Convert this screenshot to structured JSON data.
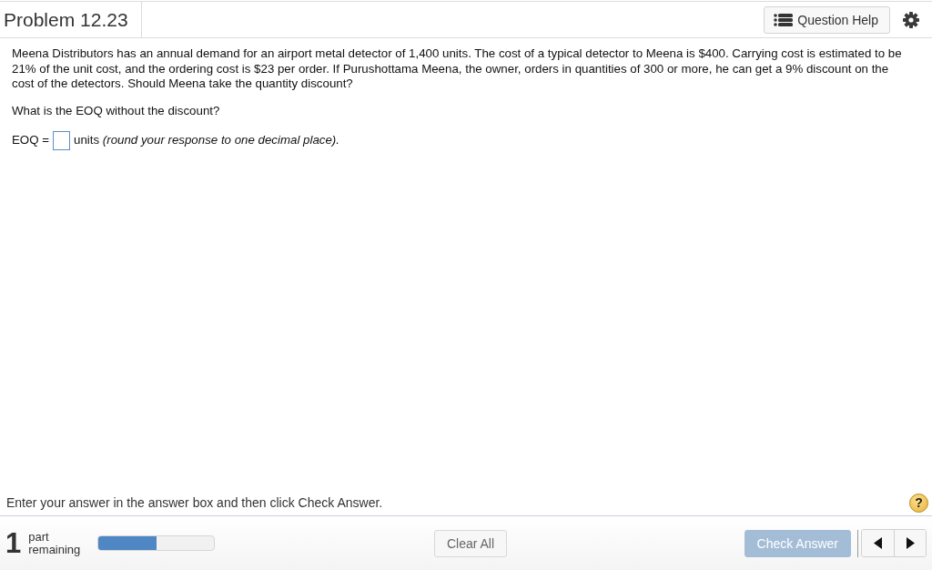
{
  "header": {
    "title": "Problem 12.23",
    "help_button": "Question Help"
  },
  "question": {
    "text": "Meena Distributors has an annual demand for an airport metal detector of 1,400 units. The cost of a typical detector to Meena is $400. Carrying cost is estimated to be 21% of the unit cost, and the ordering cost is $23 per order. If Purushottama Meena, the owner, orders in quantities of 300 or more, he can get a 9% discount on the cost of the detectors. Should Meena take the quantity discount?",
    "prompt": "What is the EOQ without the discount?",
    "answer": {
      "label": "EOQ =",
      "note": "units *(round your response to one decimal place).*"
    }
  },
  "instruction": {
    "text": "Enter your answer in the answer box and then click Check Answer.",
    "help": "?"
  },
  "footer": {
    "count": "1",
    "count_label": "part remaining",
    "progress": {
      "level": 0.5
    },
    "buttons": [
      {
        "kind": "clear",
        "label": "Clear All",
        "disabled": false
      },
      {
        "kind": "check",
        "label": "Check Answer",
        "disabled": true
      }
    ]
  }
}
